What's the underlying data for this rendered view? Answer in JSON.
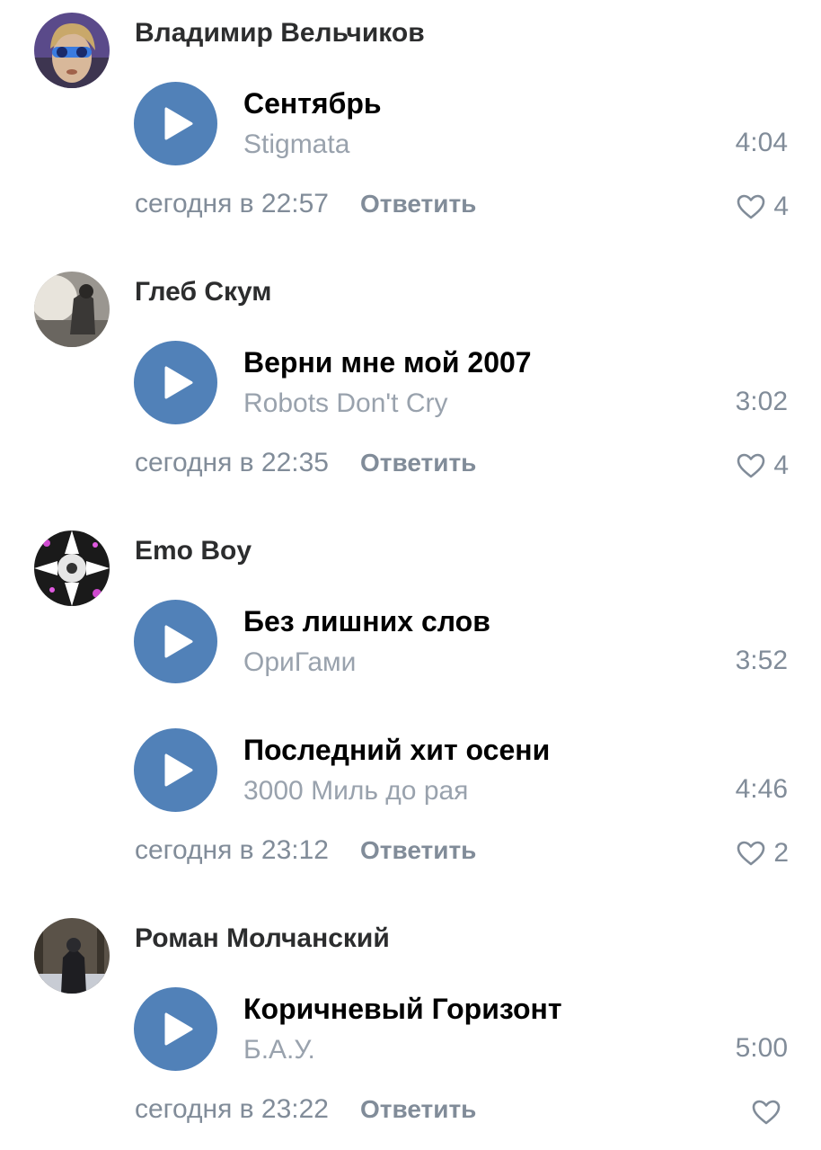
{
  "colors": {
    "play_button": "#5181b8",
    "author": "#2c2d2e",
    "secondary": "#818c99",
    "artist": "#99a2ad"
  },
  "reply_label": "Ответить",
  "comments": [
    {
      "author": "Владимир Вельчиков",
      "tracks": [
        {
          "title": "Сентябрь",
          "artist": "Stigmata",
          "duration": "4:04"
        }
      ],
      "time": "сегодня в 22:57",
      "likes": "4"
    },
    {
      "author": "Глеб Скум",
      "tracks": [
        {
          "title": "Верни мне мой 2007",
          "artist": "Robots Don't Cry",
          "duration": "3:02"
        }
      ],
      "time": "сегодня в 22:35",
      "likes": "4"
    },
    {
      "author": "Emo Boy",
      "tracks": [
        {
          "title": "Без лишних слов",
          "artist": "ОриГами",
          "duration": "3:52"
        },
        {
          "title": "Последний хит осени",
          "artist": "3000 Миль до рая",
          "duration": "4:46"
        }
      ],
      "time": "сегодня в 23:12",
      "likes": "2"
    },
    {
      "author": "Роман Молчанский",
      "tracks": [
        {
          "title": "Коричневый Горизонт",
          "artist": "Б.А.У.",
          "duration": "5:00"
        }
      ],
      "time": "сегодня в 23:22",
      "likes": ""
    }
  ]
}
